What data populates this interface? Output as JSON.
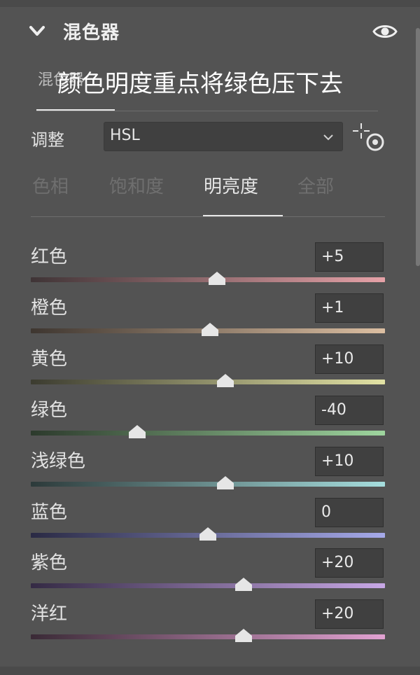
{
  "panel": {
    "title": "混色器",
    "overlay_note": "颜色明度重点将绿色压下去",
    "subtab_label": "混色器"
  },
  "adjust": {
    "label": "调整",
    "mode_value": "HSL"
  },
  "mode_tabs": [
    {
      "label": "色相",
      "active": false
    },
    {
      "label": "饱和度",
      "active": false
    },
    {
      "label": "明亮度",
      "active": true
    },
    {
      "label": "全部",
      "active": false
    }
  ],
  "sliders": [
    {
      "label": "红色",
      "value": "+5",
      "amount": 5,
      "gradient": [
        "#3f3436",
        "#e6a2a8"
      ]
    },
    {
      "label": "橙色",
      "value": "+1",
      "amount": 1,
      "gradient": [
        "#3e3630",
        "#dcbfa2"
      ]
    },
    {
      "label": "黄色",
      "value": "+10",
      "amount": 10,
      "gradient": [
        "#3c3c30",
        "#e2e2a4"
      ]
    },
    {
      "label": "绿色",
      "value": "-40",
      "amount": -40,
      "gradient": [
        "#2c3a2c",
        "#9ed59e"
      ]
    },
    {
      "label": "浅绿色",
      "value": "+10",
      "amount": 10,
      "gradient": [
        "#2c3a3a",
        "#a6dede"
      ]
    },
    {
      "label": "蓝色",
      "value": "0",
      "amount": 0,
      "gradient": [
        "#2a2a44",
        "#a6aaea"
      ]
    },
    {
      "label": "紫色",
      "value": "+20",
      "amount": 20,
      "gradient": [
        "#342a44",
        "#c8a8e6"
      ]
    },
    {
      "label": "洋红",
      "value": "+20",
      "amount": 20,
      "gradient": [
        "#3a2a36",
        "#e2a2d2"
      ]
    }
  ],
  "colors": {
    "background": "#535353",
    "input_bg": "#404040",
    "text": "#e2e2e2",
    "inactive_tab": "#6f6f6f",
    "thumb": "#e6e6e6"
  }
}
